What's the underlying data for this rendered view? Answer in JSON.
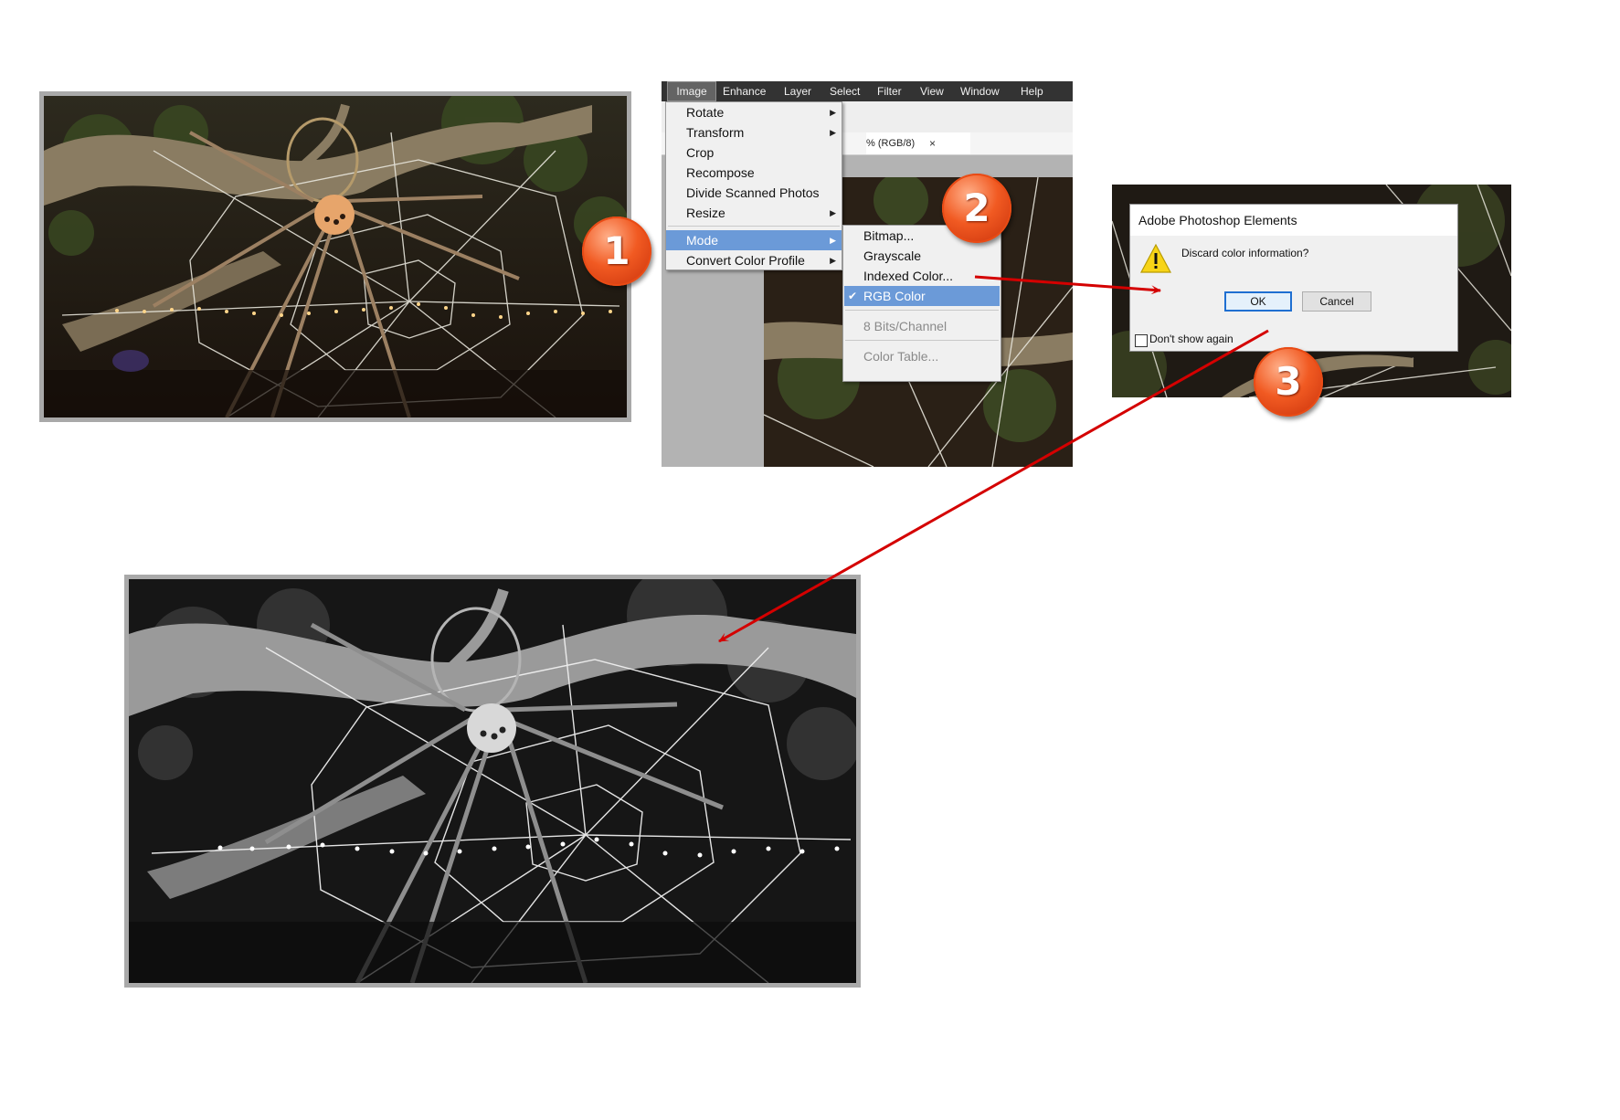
{
  "steps": {
    "one": "1",
    "two": "2",
    "three": "3"
  },
  "menubar": {
    "items": [
      "Image",
      "Enhance",
      "Layer",
      "Select",
      "Filter",
      "View",
      "Window",
      "Help"
    ]
  },
  "doc_tab": {
    "label": "% (RGB/8)",
    "close": "×"
  },
  "image_menu": {
    "items": [
      "Rotate",
      "Transform",
      "Crop",
      "Recompose",
      "Divide Scanned Photos",
      "Resize",
      "Mode",
      "Convert Color Profile"
    ]
  },
  "mode_submenu": {
    "items": [
      "Bitmap...",
      "Grayscale",
      "Indexed Color...",
      "RGB Color",
      "8 Bits/Channel",
      "Color Table..."
    ],
    "checked": "RGB Color",
    "check_mark": "✔"
  },
  "dialog": {
    "title": "Adobe Photoshop Elements",
    "message": "Discard color information?",
    "ok": "OK",
    "cancel": "Cancel",
    "dont_show": "Don't show again"
  },
  "colors": {
    "arrow": "#d40000",
    "badge": "#f15a22",
    "menu_highlight": "#6b9ad8",
    "menubar": "#333333"
  }
}
